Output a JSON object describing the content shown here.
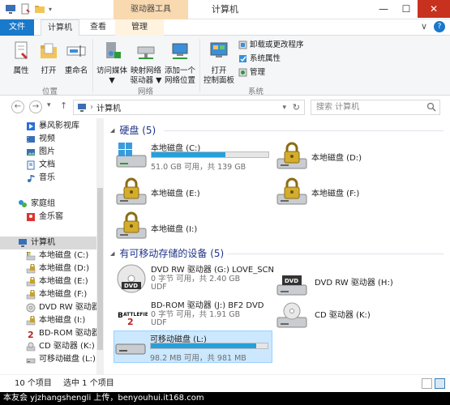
{
  "window": {
    "title": "计算机",
    "context_tab": "驱动器工具",
    "controls": {
      "minimize": "—",
      "maximize": "☐",
      "close": "✕"
    }
  },
  "ribbon_tabs": {
    "file": "文件",
    "computer": "计算机",
    "view": "查看",
    "manage": "管理",
    "collapse": "∨",
    "help": "?"
  },
  "ribbon": {
    "location": {
      "label": "位置",
      "properties": "属性",
      "open": "打开",
      "rename": "重命名"
    },
    "network": {
      "label": "网络",
      "access_media": [
        "访问媒体",
        "▼"
      ],
      "map_drive": [
        "映射网络",
        "驱动器 ▼"
      ],
      "add_location": [
        "添加一个",
        "网络位置"
      ]
    },
    "system": {
      "label": "系统",
      "control_panel": [
        "打开",
        "控制面板"
      ],
      "uninstall": "卸载或更改程序",
      "sys_props": "系统属性",
      "manage": "管理"
    }
  },
  "navigation": {
    "back": "←",
    "forward": "→",
    "recent": "▾",
    "up": "↑",
    "address": "计算机",
    "separator": "›",
    "dropdown": "▾",
    "refresh": "↻",
    "search_placeholder": "搜索 计算机"
  },
  "sidebar": {
    "items": [
      {
        "label": "暴风影视库",
        "icon": "media-library-icon",
        "color": "#2b6fd6"
      },
      {
        "label": "视频",
        "icon": "video-folder-icon",
        "color": "#3a6fb5"
      },
      {
        "label": "图片",
        "icon": "pictures-folder-icon",
        "color": "#3a6fb5"
      },
      {
        "label": "文档",
        "icon": "documents-folder-icon",
        "color": "#3a6fb5"
      },
      {
        "label": "音乐",
        "icon": "music-folder-icon",
        "color": "#3a6fb5"
      },
      {
        "label": "家庭组",
        "icon": "homegroup-icon",
        "color": "#2f8fd8"
      },
      {
        "label": "金乐窖",
        "icon": "user-icon",
        "color": "#d33"
      },
      {
        "label": "计算机",
        "icon": "computer-icon",
        "color": "#3a6fb5"
      },
      {
        "label": "本地磁盘 (C:)",
        "icon": "system-drive-icon",
        "color": "#777"
      },
      {
        "label": "本地磁盘 (D:)",
        "icon": "locked-drive-icon",
        "color": "#c9a227"
      },
      {
        "label": "本地磁盘 (E:)",
        "icon": "locked-drive-icon",
        "color": "#c9a227"
      },
      {
        "label": "本地磁盘 (F:)",
        "icon": "locked-drive-icon",
        "color": "#c9a227"
      },
      {
        "label": "DVD RW 驱动器",
        "icon": "dvd-icon",
        "color": "#888"
      },
      {
        "label": "本地磁盘 (I:)",
        "icon": "locked-drive-icon",
        "color": "#c9a227"
      },
      {
        "label": "BD-ROM 驱动器",
        "icon": "bd-disc-icon",
        "color": "#b22"
      },
      {
        "label": "CD 驱动器 (K:)",
        "icon": "cd-drive-icon",
        "color": "#888"
      },
      {
        "label": "可移动磁盘 (L:)",
        "icon": "removable-drive-icon",
        "color": "#888"
      }
    ]
  },
  "main": {
    "hard_disks": {
      "header": "硬盘 (5)",
      "drives": [
        {
          "name": "本地磁盘 (C:)",
          "usage": 0.63,
          "detail": "51.0 GB 可用，共 139 GB",
          "icon": "system-drive-icon"
        },
        {
          "name": "本地磁盘 (D:)",
          "icon": "locked-drive-icon"
        },
        {
          "name": "本地磁盘 (E:)",
          "icon": "locked-drive-icon"
        },
        {
          "name": "本地磁盘 (F:)",
          "icon": "locked-drive-icon"
        },
        {
          "name": "本地磁盘 (I:)",
          "icon": "locked-drive-icon"
        }
      ]
    },
    "removable": {
      "header": "有可移动存储的设备 (5)",
      "devices": [
        {
          "name": "DVD RW 驱动器 (G:) LOVE_SCN",
          "detail": "0 字节 可用，共 2.40 GB",
          "fs": "UDF",
          "icon": "dvd-disc-icon"
        },
        {
          "name": "DVD RW 驱动器 (H:)",
          "icon": "dvd-drive-icon"
        },
        {
          "name": "BD-ROM 驱动器 (J:) BF2 DVD",
          "detail": "0 字节 可用，共 1.91 GB",
          "fs": "UDF",
          "icon": "battlefield-disc-icon"
        },
        {
          "name": "CD 驱动器 (K:)",
          "icon": "cd-drive-icon"
        },
        {
          "name": "可移动磁盘 (L:)",
          "usage": 0.9,
          "detail": "98.2 MB 可用，共 981 MB",
          "icon": "removable-drive-icon"
        }
      ]
    }
  },
  "status": {
    "count": "10 个项目",
    "selected": "选中 1 个项目"
  },
  "watermark": "本友会 yjzhangshengli 上传，benyouhui.it168.com"
}
